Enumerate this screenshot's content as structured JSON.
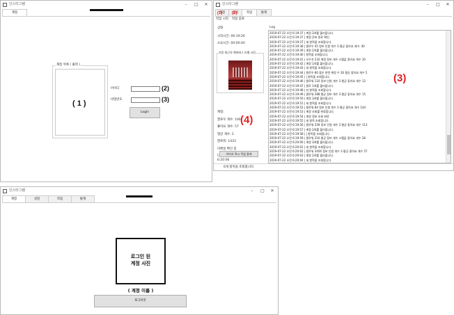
{
  "w1": {
    "title": "인스타그램",
    "tabs": [
      "계정"
    ],
    "group_label": "계정 목록 ( 출력 )",
    "num1": "( 1 )",
    "id_label": "아이디",
    "pw_label": "비밀번호",
    "num2": "(2)",
    "num3": "(3)",
    "login": "Login"
  },
  "w2": {
    "title": "인스타그램",
    "tabs": [
      "계정",
      "설정",
      "작업",
      "통계"
    ],
    "tab_nums": [
      "(1)",
      "(2)"
    ],
    "toolbar": [
      "작업 시작",
      "작업 중료"
    ],
    "section_label": "상태",
    "start_time": "시작시간: 06:19:26",
    "elapsed": "소요시간: 00:00:40",
    "hashtag_title": "가장 최근의 해쉬태그 라벨 사진",
    "account": "계정:",
    "follows": "팔로우 개수: 100",
    "likes": "좋아요 개수: 57",
    "comments": "댓글 개수: 2",
    "follow_total": "팔로워: 1433",
    "current_status": "이메일 확인 중",
    "next_time": "다음 실행: 2019-07-22 오전 6:20:06",
    "next_btn": "이어서 즉시 작업 중개",
    "num4": "(4)",
    "log_label": "Log",
    "num3": "(3)",
    "status_text": "6개 항목을 조회합니다.",
    "log": [
      "2019-07-22 오전 6:19:37  |              계정 2/4를 불러옵니다.",
      "2019-07-22 오전 6:19:37  | 계정 준비 완료 확인.",
      "2019-07-22 오전 6:19:37  |        새 항목을 조회합니다.",
      "2019-07-22 오전 6:19:38  |          팔로우 45        정보 인원 개수 3 평균 좋아요 개수: 40",
      "2019-07-22 오전 6:19:39  |          계정 2/4를 불러옵니다.",
      "2019-07-22 오전 6:19:40  |          항목을 조회합니다.",
      "2019-07-22 오전 6:19:41  |               오우치 232        계정 정보 개수 스팸값 좋아요 개수 10",
      "2019-07-22 오전 6:19:42  |          계정 1/4를 불러옵니다.",
      "2019-07-22 오전 6:19:43  |    새 항목을 조회합니다.",
      "2019-07-22 오전 6:19:44  |    팔로우 80          좋은 관련 계정 수 30 평균 좋아요 개수 5",
      "2019-07-22 오전 6:19:45  |  | 항목을 조회합니다.",
      "2019-07-22 오전 6:19:46  |          팔로워 110        정보 인원 개수 3 평균 좋아요 개수 12",
      "2019-07-22 오전 6:19:47  |          팔로 1/4를 불러옵니다.",
      "2019-07-22 오전 6:19:48  |          지 항목을 조회합니다.",
      "2019-07-22 오전 6:19:49  |                  팔로워 288        평균 정보 개수 3 평균 좋아요 개수 15",
      "2019-07-22 오전 6:19:50  |              계정 3/4를 불러옵니다.",
      "2019-07-22 오전 6:19:51  |              새 항목을 조회합니다.",
      "2019-07-22 오전 6:19:52  |            팔로워 84        정보 인원 개수 3 평균 좋아요 개수 144",
      "2019-07-22 오전 6:19:53  |          계정 조회를 완료합니다.",
      "2019-07-22 오전 6:19:54  | 계정 정보 조회 완료",
      "2019-07-22 오전 6:19:55  |          새 항목 조회합니다.",
      "2019-07-22 오전 6:19:56  | 팔로워 339        정보 인원 개수 3 평균 좋아요 개수 113",
      "2019-07-22 오전 6:19:57  |          계정 2/4를 불러옵니다.",
      "2019-07-22 오전 6:19:58  |  | 항목을 조회합니다.",
      "2019-07-22 오전 6:19:59  |          팔로워 210        평균 정보 개수 스팸값 좋아요 개수 28",
      "2019-07-22 오전 6:20:00  |          계정 3/4를 불러옵니다.",
      "2019-07-22 오전 6:20:01  |          새 항목을 조회합니다.",
      "2019-07-22 오전 6:20:02  |          팔로워 3456        정보 인원 개수 3 평균 좋아요 개수 57",
      "2019-07-22 오전 6:20:03  |          계정 2/4를 불러옵니다.",
      "2019-07-22 오전 6:20:04  |  새 항목을 조회합니다.",
      "2019-07-22 오전 6:20:05  |          팔로워 84        정보 인원 개수 3 평균 좋아요 개수 28",
      "2019-07-22 오전 6:20:06  |    항목을 조회합니다."
    ]
  },
  "w3": {
    "title": "인스타그램",
    "tabs": [
      "계정",
      "설정",
      "작업",
      "통계"
    ],
    "photo_line1": "로그인 된",
    "photo_line2": "계정 사진",
    "account_name": "( 계정 이름 )",
    "logout": "로그아웃"
  }
}
